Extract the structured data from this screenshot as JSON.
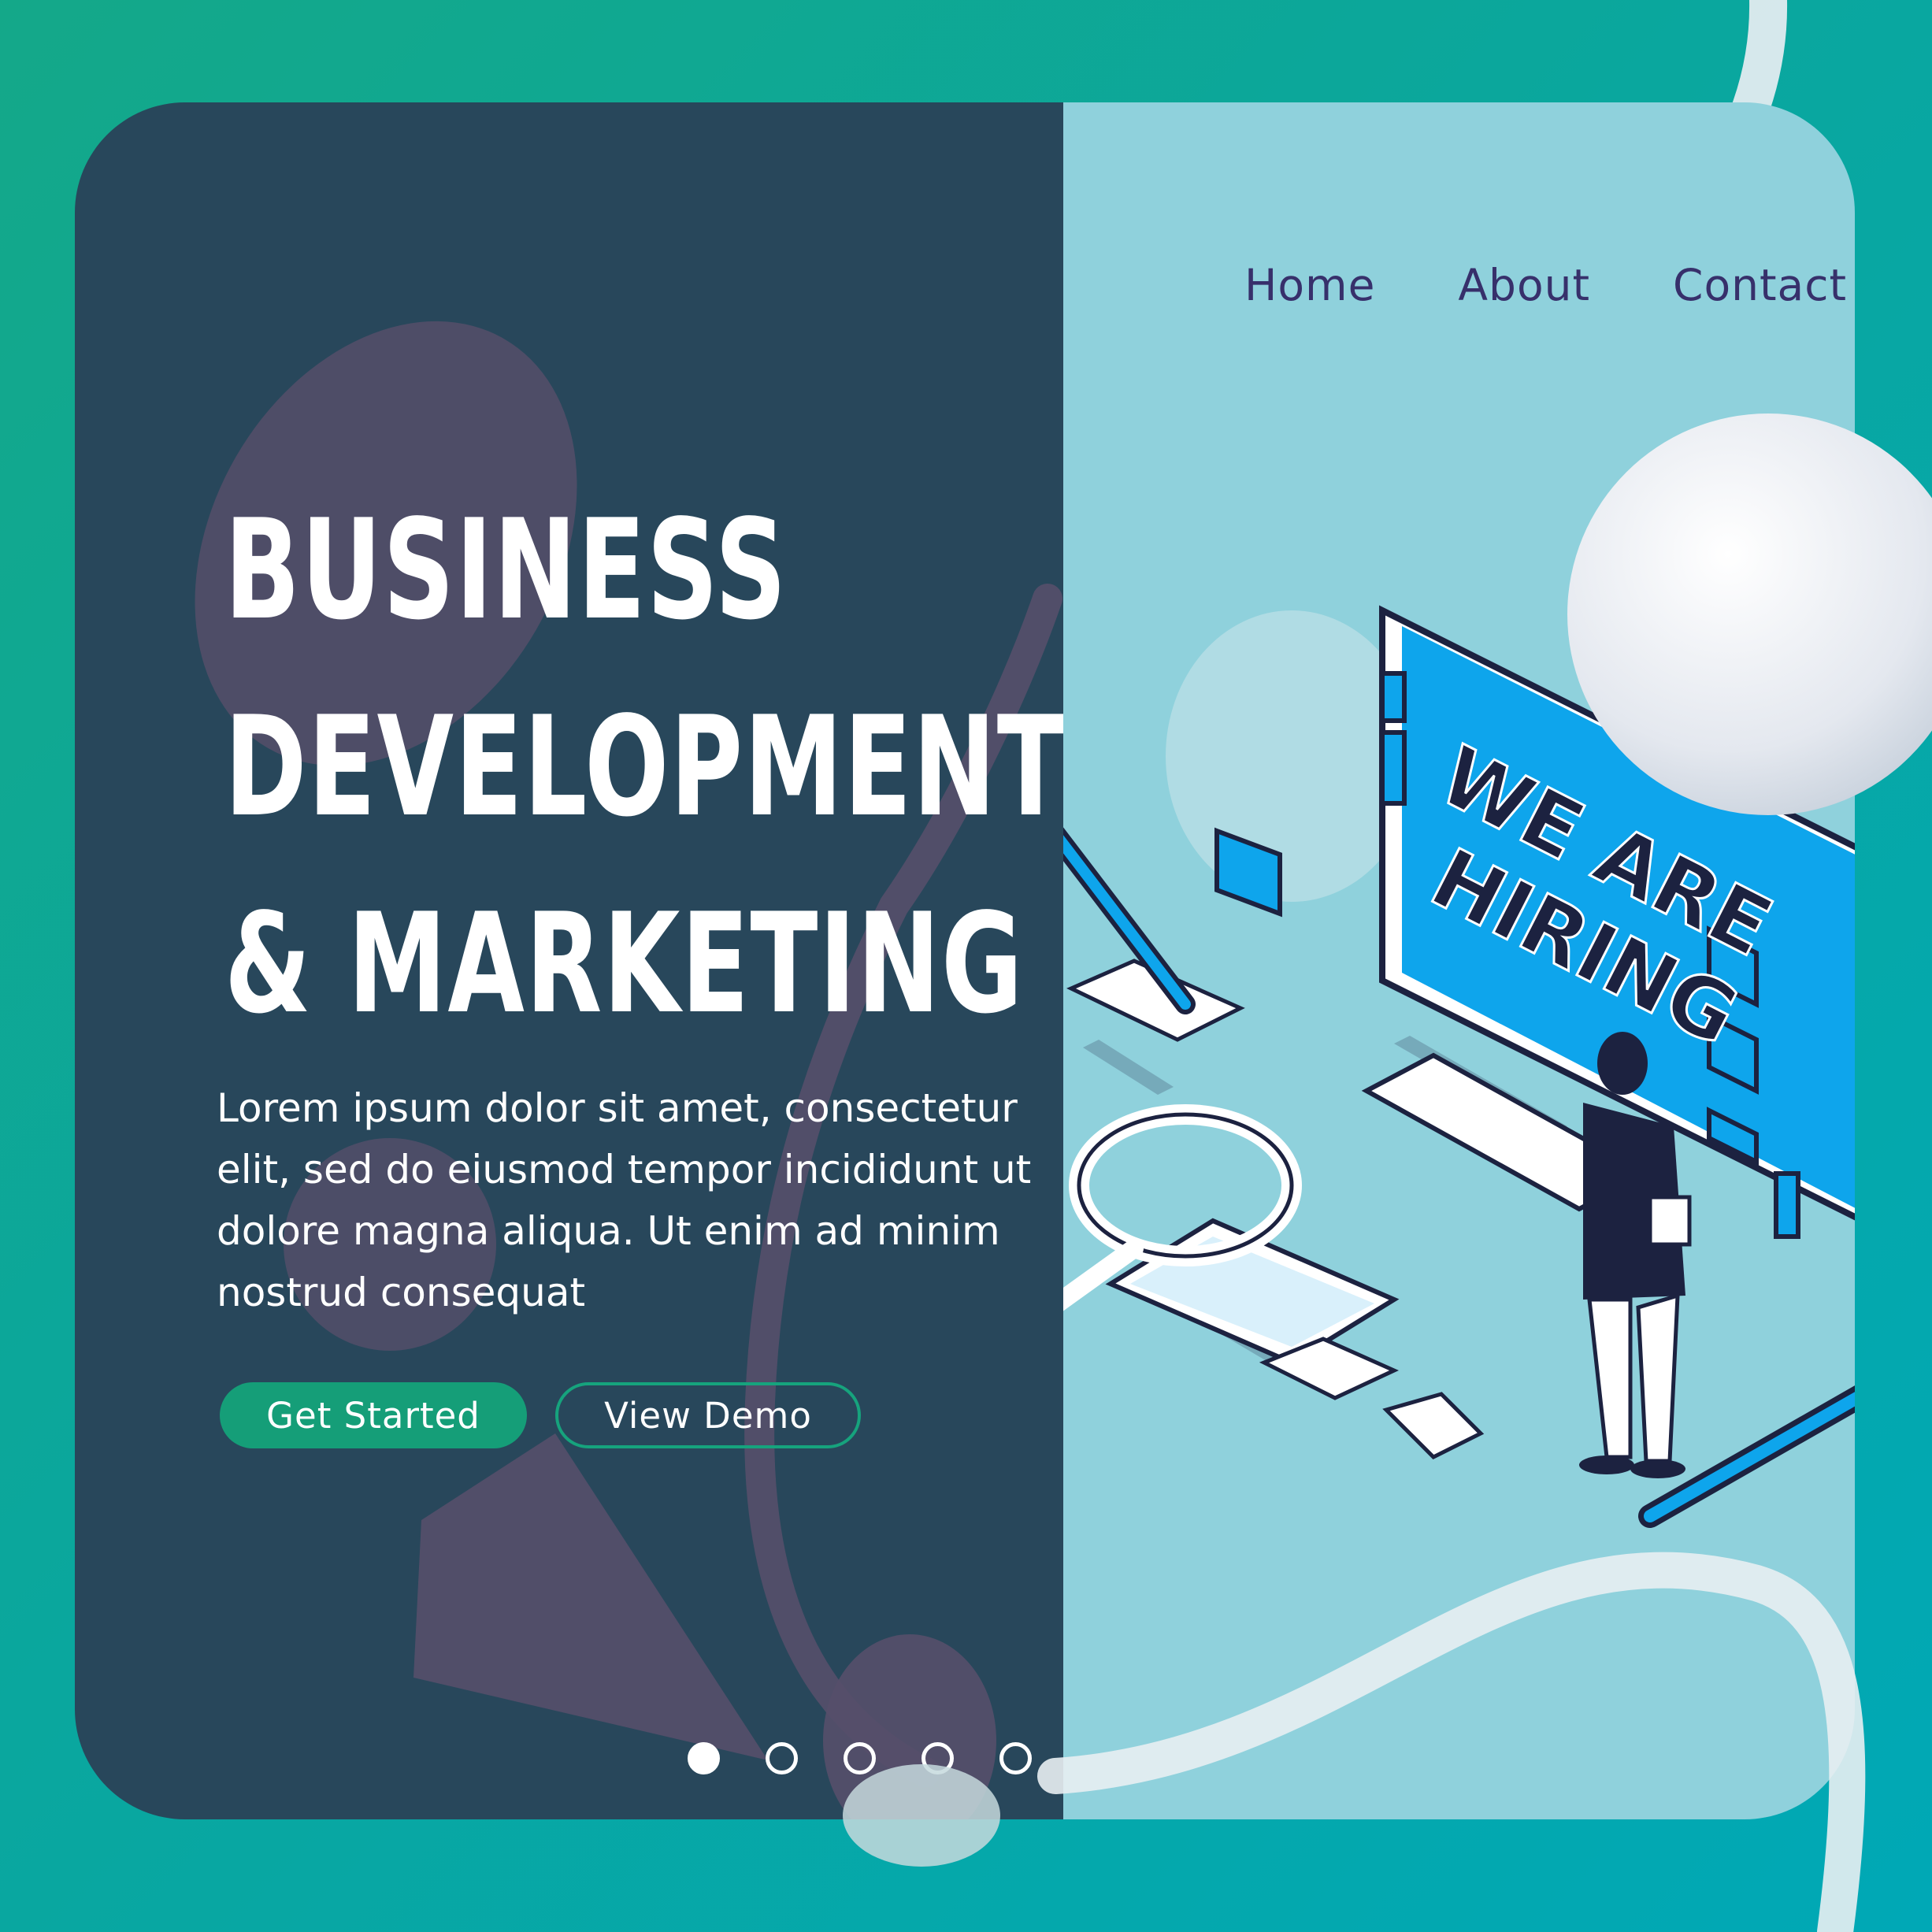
{
  "nav": {
    "items": [
      {
        "label": "Home"
      },
      {
        "label": "About"
      },
      {
        "label": "Contact"
      }
    ]
  },
  "hero": {
    "headline_lines": [
      "BUSINESS",
      "DEVELOPMENT",
      "& MARKETING"
    ],
    "body": "Lorem ipsum dolor sit amet, consectetur elit, sed do eiusmod tempor incididunt ut dolore magna aliqua. Ut enim ad minim nostrud consequat",
    "primary_button": "Get Started",
    "secondary_button": "View Demo"
  },
  "illustration": {
    "sign_lines": [
      "WE ARE",
      "HIRING"
    ]
  },
  "carousel": {
    "count": 5,
    "active_index": 0
  },
  "colors": {
    "background_gradient": [
      "#14a889",
      "#00a8b6"
    ],
    "left_panel": "#28475b",
    "right_panel": "#8fd1dc",
    "nav_text": "#37306b",
    "primary_button": "#159e78",
    "sign_blue": "#0ea5ec"
  }
}
